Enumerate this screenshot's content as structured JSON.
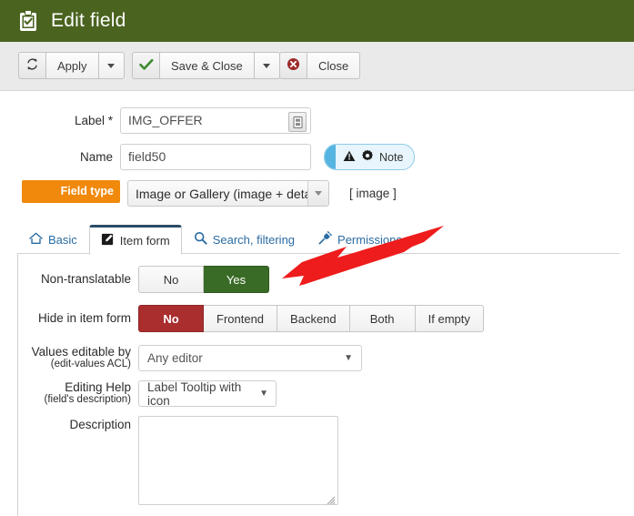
{
  "window": {
    "title": "Edit field",
    "title_icon": "clipboard-check-icon",
    "header_bg": "#4a631f"
  },
  "toolbar": {
    "apply_label": "Apply",
    "apply_icon": "refresh-icon",
    "apply_caret_icon": "caret-down-icon",
    "save_close_label": "Save & Close",
    "save_close_icon": "check-icon",
    "save_close_caret_icon": "caret-down-icon",
    "close_label": "Close",
    "close_icon": "cancel-circle-icon"
  },
  "form": {
    "label_field": {
      "label": "Label *",
      "value": "IMG_OFFER",
      "placeholder": "",
      "inner_icon": "multilingual-toggle-icon"
    },
    "name_field": {
      "label": "Name",
      "value": "field50",
      "placeholder": ""
    },
    "note_badge": {
      "text": "Note",
      "warning_icon": "warning-triangle-icon",
      "gear_icon": "gear-icon",
      "accent": "#56b4e0"
    },
    "field_type": {
      "label": "Field type",
      "label_bg": "#f0890c",
      "value": "Image or Gallery (image + details)",
      "options": [
        "Image or Gallery (image + details)"
      ],
      "suffix": "[ image ]"
    }
  },
  "tabs": [
    {
      "label": "Basic",
      "icon": "home-icon",
      "active": false
    },
    {
      "label": "Item form",
      "icon": "edit-square-icon",
      "active": true
    },
    {
      "label": "Search, filtering",
      "icon": "search-icon",
      "active": false
    },
    {
      "label": "Permissions",
      "icon": "plug-icon",
      "active": false
    }
  ],
  "item_form": {
    "non_translatable": {
      "label": "Non-translatable",
      "options": [
        "No",
        "Yes"
      ],
      "selected": "Yes",
      "selected_color": "#3a6b26"
    },
    "hide_in_item_form": {
      "label": "Hide in item form",
      "options": [
        "No",
        "Frontend",
        "Backend",
        "Both",
        "If empty"
      ],
      "selected": "No",
      "selected_color": "#aa2e2e"
    },
    "values_editable_by": {
      "label": "Values editable by",
      "sublabel": "(edit-values ACL)",
      "value": "Any editor",
      "options": [
        "Any editor"
      ]
    },
    "editing_help": {
      "label": "Editing Help",
      "sublabel": "(field's description)",
      "value": "Label Tooltip with icon",
      "options": [
        "Label Tooltip with icon"
      ]
    },
    "description": {
      "label": "Description",
      "value": "",
      "placeholder": ""
    }
  },
  "annotation": {
    "arrow_color": "#ee1c1c",
    "arrow_target": "non-translatable-yes-button"
  }
}
